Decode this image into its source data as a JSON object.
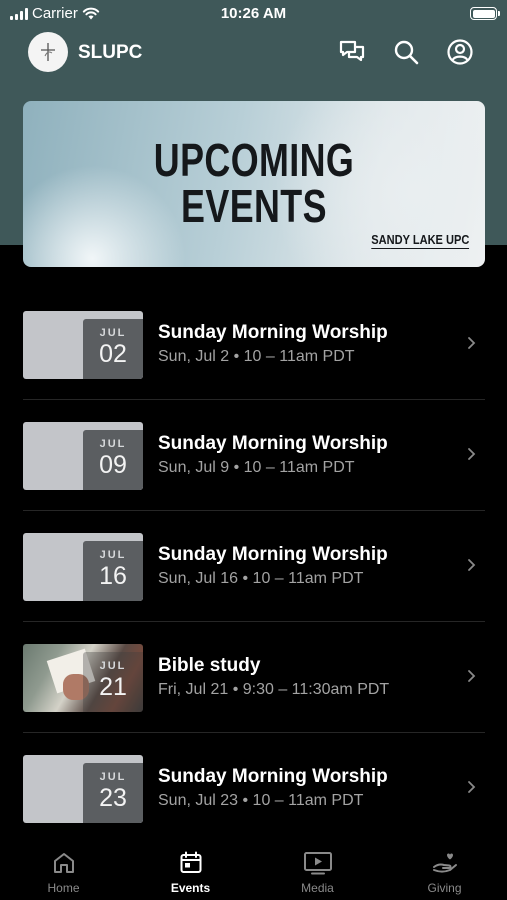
{
  "status_bar": {
    "carrier": "Carrier",
    "time": "10:26 AM"
  },
  "header": {
    "brand": "SLUPC",
    "icons": [
      "chat-icon",
      "search-icon",
      "account-icon"
    ]
  },
  "banner": {
    "title_line1": "UPCOMING",
    "title_line2": "EVENTS",
    "subtitle": "SANDY LAKE UPC"
  },
  "events": [
    {
      "month": "JUL",
      "day": "02",
      "title": "Sunday Morning Worship",
      "time": "Sun, Jul 2 • 10 – 11am PDT",
      "thumbnail": "plain"
    },
    {
      "month": "JUL",
      "day": "09",
      "title": "Sunday Morning Worship",
      "time": "Sun, Jul 9 • 10 – 11am PDT",
      "thumbnail": "plain"
    },
    {
      "month": "JUL",
      "day": "16",
      "title": "Sunday Morning Worship",
      "time": "Sun, Jul 16 • 10 – 11am PDT",
      "thumbnail": "plain"
    },
    {
      "month": "JUL",
      "day": "21",
      "title": "Bible study",
      "time": "Fri, Jul 21 • 9:30 – 11:30am PDT",
      "thumbnail": "photo"
    },
    {
      "month": "JUL",
      "day": "23",
      "title": "Sunday Morning Worship",
      "time": "Sun, Jul 23 • 10 – 11am PDT",
      "thumbnail": "plain"
    }
  ],
  "tabs": [
    {
      "label": "Home",
      "icon": "home-icon",
      "active": false
    },
    {
      "label": "Events",
      "icon": "calendar-icon",
      "active": true
    },
    {
      "label": "Media",
      "icon": "media-icon",
      "active": false
    },
    {
      "label": "Giving",
      "icon": "giving-icon",
      "active": false
    }
  ],
  "colors": {
    "header_bg": "#3f5859",
    "background": "#000000",
    "date_box": "#5b5e61",
    "muted_text": "#a3a3a3"
  }
}
